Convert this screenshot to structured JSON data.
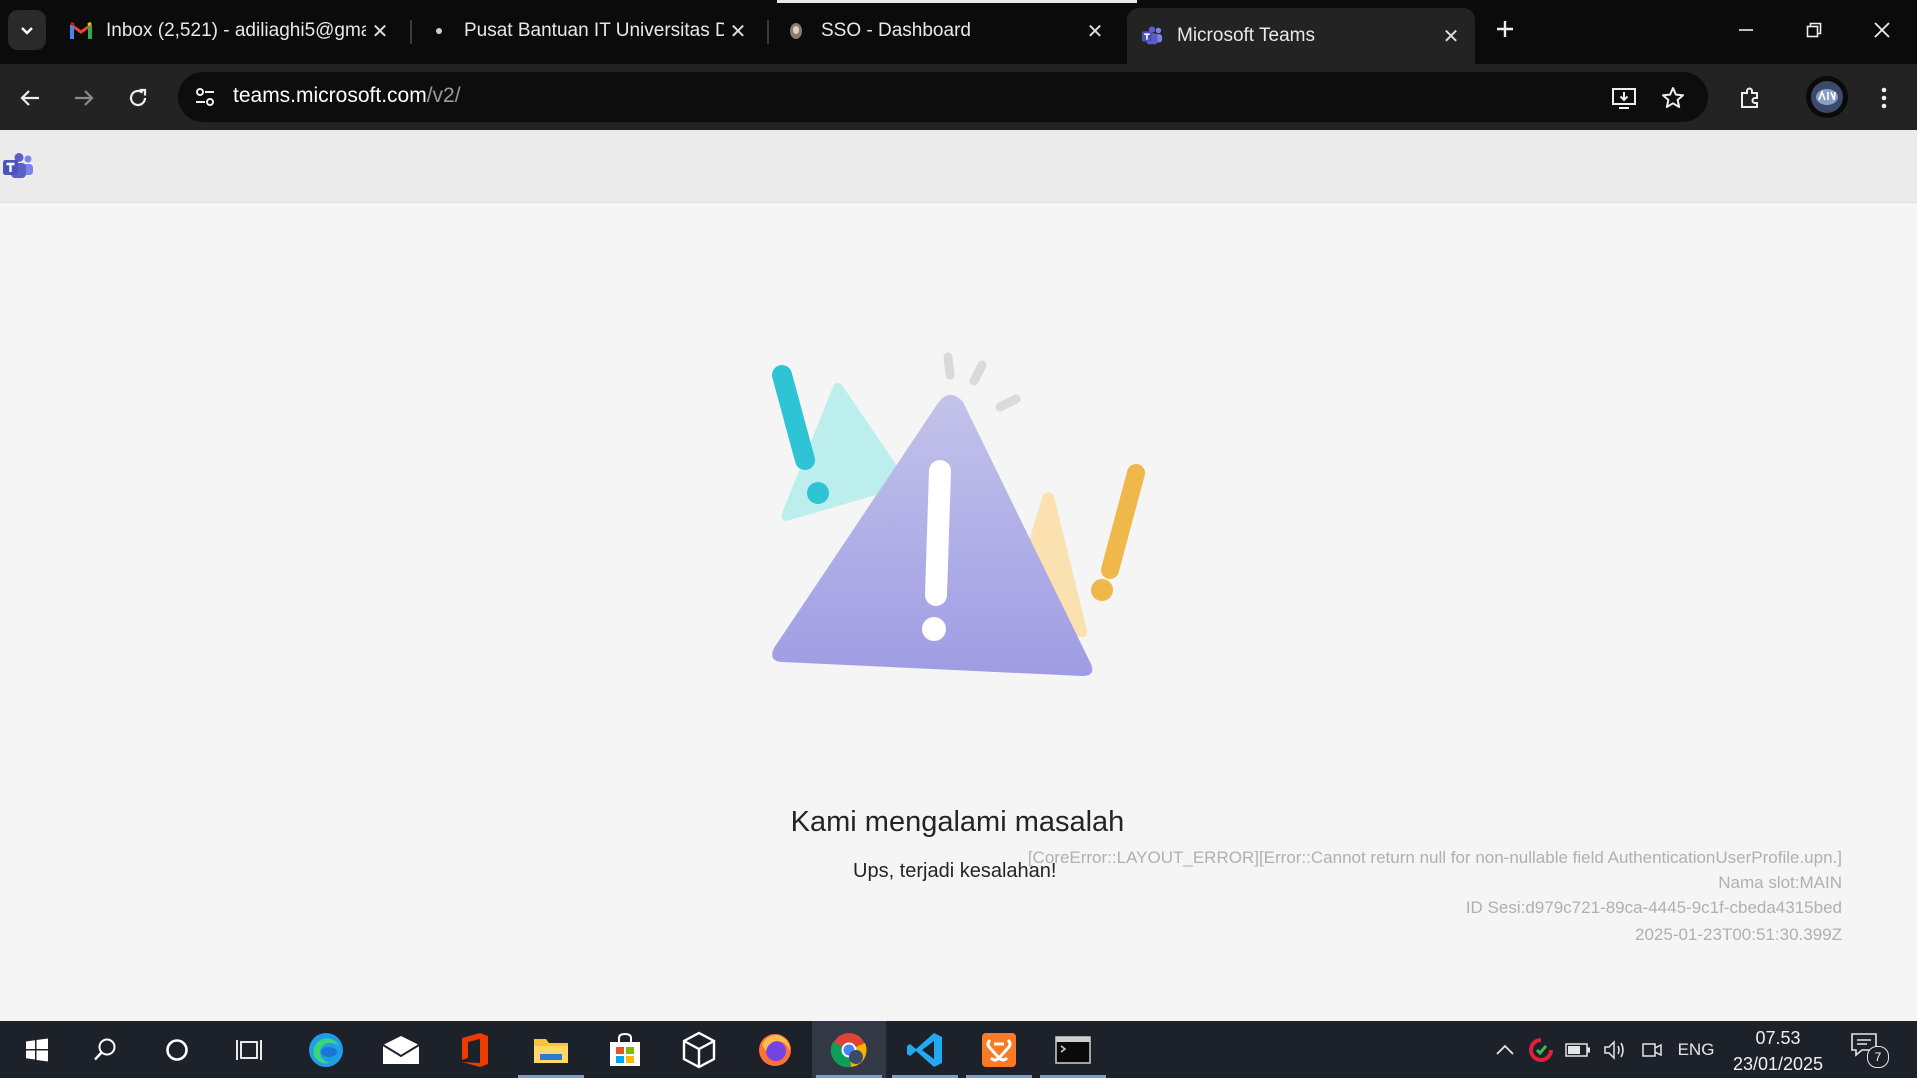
{
  "browser": {
    "tabs": [
      {
        "title": "Inbox (2,521) - adiliaghi5@gma",
        "favicon": "gmail-icon",
        "active": false
      },
      {
        "title": "Pusat Bantuan IT Universitas Di",
        "favicon": "university-icon",
        "active": false
      },
      {
        "title": "SSO - Dashboard",
        "favicon": "sso-icon",
        "active": false
      },
      {
        "title": "Microsoft Teams",
        "favicon": "teams-icon",
        "active": true
      }
    ],
    "url_host": "teams.microsoft.com",
    "url_path": "/v2/"
  },
  "error": {
    "title": "Kami mengalami masalah",
    "subtitle": "Ups, terjadi kesalahan!",
    "details": [
      "[CoreError::LAYOUT_ERROR][Error::Cannot return null for non-nullable field AuthenticationUserProfile.upn.]",
      "Nama slot:MAIN",
      "ID Sesi:d979c721-89ca-4445-9c1f-cbeda4315bed",
      "2025-01-23T00:51:30.399Z"
    ]
  },
  "taskbar": {
    "apps": [
      "start",
      "search",
      "cortana",
      "task-view",
      "edge",
      "mail",
      "office",
      "file-explorer",
      "store",
      "virtualbox",
      "firefox",
      "chrome",
      "vscode",
      "xampp",
      "terminal"
    ],
    "language": "ENG",
    "time": "07.53",
    "date": "23/01/2025",
    "notification_count": "7"
  },
  "colors": {
    "accent_teams": "#5b5fc7",
    "warning_purple": "#a9a6e8",
    "warning_teal": "#2ec4d6",
    "warning_yellow": "#f0b74a"
  }
}
